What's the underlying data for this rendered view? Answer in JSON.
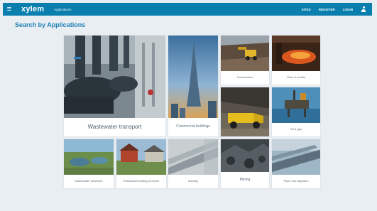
{
  "header": {
    "logo": "xylem",
    "app_label": "Applications",
    "nav": [
      "SITES",
      "REGISTER",
      "LOGIN"
    ]
  },
  "page_title": "Search by Applications",
  "tiles": [
    {
      "label": "Wastewater transport"
    },
    {
      "label": "Commercial buildings"
    },
    {
      "label": "Construction"
    },
    {
      "label": "Steel & metals"
    },
    {
      "label": "Oil & gas"
    },
    {
      "label": "Wastewater treatment"
    },
    {
      "label": "Residential building services"
    },
    {
      "label": "Industry"
    },
    {
      "label": "Mining"
    },
    {
      "label": "Pipes and digestion"
    }
  ]
}
